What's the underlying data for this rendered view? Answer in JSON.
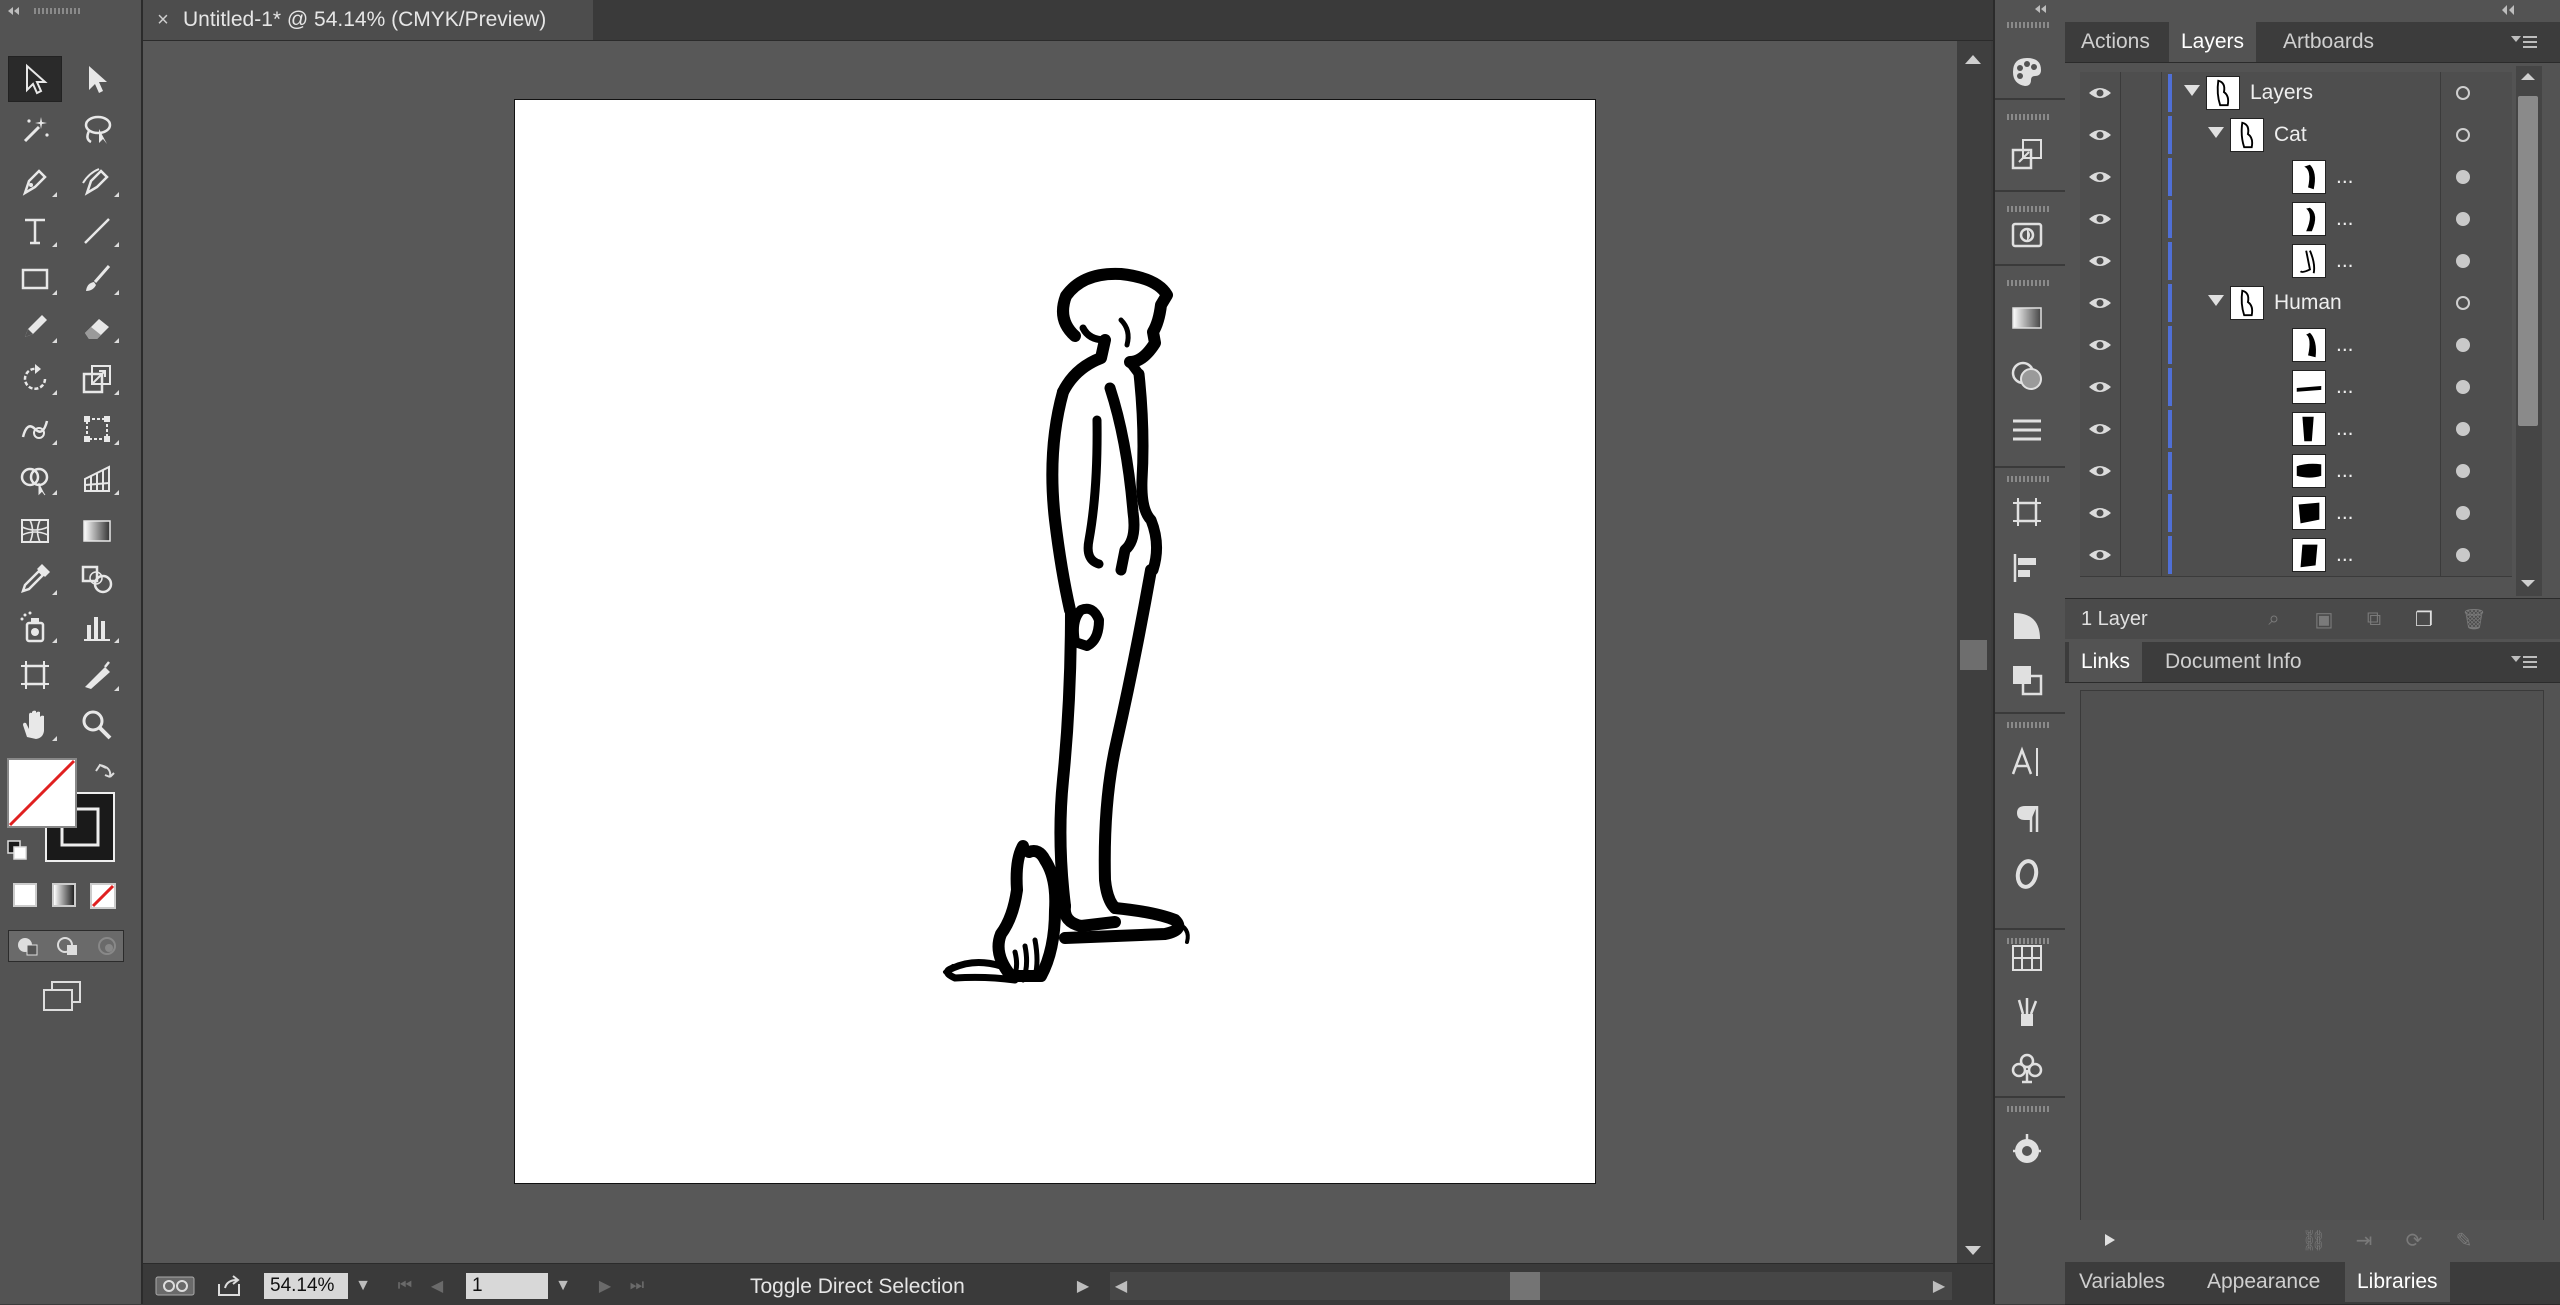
{
  "document": {
    "tab_title": "Untitled-1* @ 54.14% (CMYK/Preview)",
    "close_glyph": "×"
  },
  "toolbar": {
    "tools": [
      {
        "name": "selection-tool",
        "icon": "selection-arrow-icon",
        "selected": true
      },
      {
        "name": "direct-selection-tool",
        "icon": "direct-selection-arrow-icon"
      },
      {
        "name": "magic-wand-tool",
        "icon": "magic-wand-icon"
      },
      {
        "name": "lasso-tool",
        "icon": "lasso-icon"
      },
      {
        "name": "pen-tool",
        "icon": "pen-icon"
      },
      {
        "name": "curvature-tool",
        "icon": "curvature-pen-icon"
      },
      {
        "name": "type-tool",
        "icon": "type-icon"
      },
      {
        "name": "line-segment-tool",
        "icon": "line-icon"
      },
      {
        "name": "rectangle-tool",
        "icon": "rectangle-icon"
      },
      {
        "name": "paintbrush-tool",
        "icon": "paintbrush-icon"
      },
      {
        "name": "pencil-tool",
        "icon": "pencil-icon"
      },
      {
        "name": "eraser-tool",
        "icon": "eraser-icon"
      },
      {
        "name": "rotate-tool",
        "icon": "rotate-icon"
      },
      {
        "name": "scale-tool",
        "icon": "scale-icon"
      },
      {
        "name": "warp-tool",
        "icon": "warp-icon"
      },
      {
        "name": "free-transform-tool",
        "icon": "free-transform-icon"
      },
      {
        "name": "shape-builder-tool",
        "icon": "shape-builder-icon"
      },
      {
        "name": "perspective-grid-tool",
        "icon": "perspective-grid-icon"
      },
      {
        "name": "mesh-tool",
        "icon": "mesh-icon"
      },
      {
        "name": "gradient-tool",
        "icon": "gradient-icon"
      },
      {
        "name": "eyedropper-tool",
        "icon": "eyedropper-icon"
      },
      {
        "name": "blend-tool",
        "icon": "blend-icon"
      },
      {
        "name": "symbol-sprayer-tool",
        "icon": "symbol-sprayer-icon"
      },
      {
        "name": "column-graph-tool",
        "icon": "column-graph-icon"
      },
      {
        "name": "artboard-tool",
        "icon": "artboard-icon"
      },
      {
        "name": "slice-tool",
        "icon": "slice-icon"
      },
      {
        "name": "hand-tool",
        "icon": "hand-icon"
      },
      {
        "name": "zoom-tool",
        "icon": "zoom-icon"
      }
    ]
  },
  "status": {
    "zoom_value": "54.14%",
    "artboard_number": "1",
    "status_text": "Toggle Direct Selection"
  },
  "panels": {
    "top_tabs": [
      "Actions",
      "Layers",
      "Artboards"
    ],
    "active_top_tab": "Layers",
    "layers": [
      {
        "name": "Layers",
        "level": 0,
        "expanded": true,
        "target": "hollow"
      },
      {
        "name": "Cat",
        "level": 1,
        "expanded": true,
        "target": "hollow"
      },
      {
        "name": "...",
        "level": 2,
        "target": "filled"
      },
      {
        "name": "...",
        "level": 2,
        "target": "filled"
      },
      {
        "name": "...",
        "level": 2,
        "target": "filled"
      },
      {
        "name": "Human",
        "level": 1,
        "expanded": true,
        "target": "hollow"
      },
      {
        "name": "...",
        "level": 2,
        "target": "filled"
      },
      {
        "name": "...",
        "level": 2,
        "target": "filled"
      },
      {
        "name": "...",
        "level": 2,
        "target": "filled"
      },
      {
        "name": "...",
        "level": 2,
        "target": "filled"
      },
      {
        "name": "...",
        "level": 2,
        "target": "filled"
      },
      {
        "name": "...",
        "level": 2,
        "target": "filled"
      }
    ],
    "layers_count_label": "1 Layer",
    "mid_tabs": [
      "Links",
      "Document Info"
    ],
    "active_mid_tab": "Links",
    "bottom_tabs": [
      "Variables",
      "Appearance",
      "Libraries"
    ],
    "active_bottom_tab": "Libraries"
  },
  "colors": {
    "layer_color_bar": "#4f6fd6",
    "panel_bg": "#535353",
    "canvas_bg": "#585858"
  }
}
